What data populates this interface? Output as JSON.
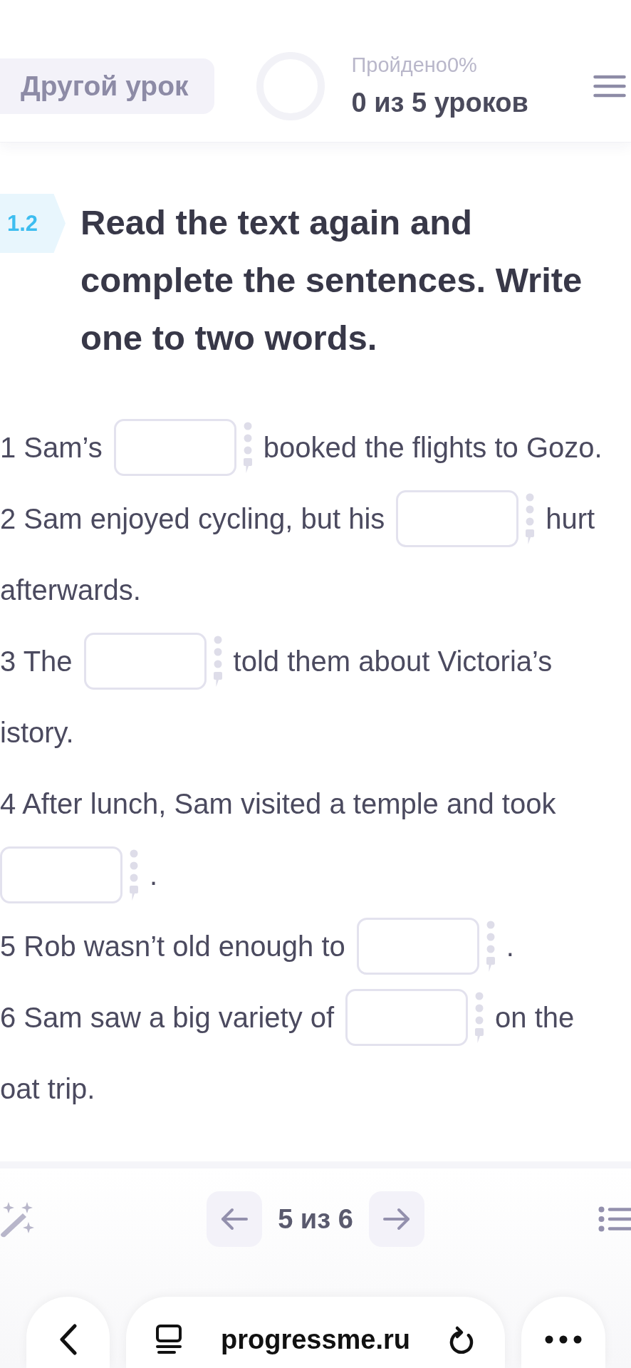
{
  "header": {
    "other_lesson_button": "Другой урок",
    "progress": {
      "label": "Пройдено0%",
      "count": "0 из 5 уроков"
    }
  },
  "task": {
    "number": "1.2",
    "instruction": "Read the text again and complete the sentences. Write one to two words."
  },
  "sentences": [
    {
      "parts": [
        {
          "kind": "text",
          "text": "1 Sam’s"
        },
        {
          "kind": "blank"
        },
        {
          "kind": "text",
          "text": "booked the flights to Gozo."
        }
      ]
    },
    {
      "parts": [
        {
          "kind": "text",
          "text": "2 Sam enjoyed cycling, but his"
        },
        {
          "kind": "blank"
        },
        {
          "kind": "text",
          "text": "hurt"
        },
        {
          "kind": "text",
          "text": "afterwards."
        }
      ]
    },
    {
      "parts": [
        {
          "kind": "text",
          "text": "3 The"
        },
        {
          "kind": "blank"
        },
        {
          "kind": "text",
          "text": "told them about Victoria’s"
        },
        {
          "kind": "text",
          "text": "istory."
        }
      ]
    },
    {
      "parts": [
        {
          "kind": "text",
          "text": "4 After lunch, Sam visited a temple and took"
        },
        {
          "kind": "blank"
        },
        {
          "kind": "text",
          "text": "."
        }
      ]
    },
    {
      "parts": [
        {
          "kind": "text",
          "text": "5 Rob wasn’t old enough to"
        },
        {
          "kind": "blank"
        },
        {
          "kind": "text",
          "text": "."
        }
      ]
    },
    {
      "parts": [
        {
          "kind": "text",
          "text": "6 Sam saw a big variety of"
        },
        {
          "kind": "blank"
        },
        {
          "kind": "text",
          "text": "on the"
        },
        {
          "kind": "text",
          "text": "oat trip."
        }
      ]
    }
  ],
  "pager": {
    "label": "5 из 6"
  },
  "browser_bar": {
    "url": "progressme.ru"
  }
}
